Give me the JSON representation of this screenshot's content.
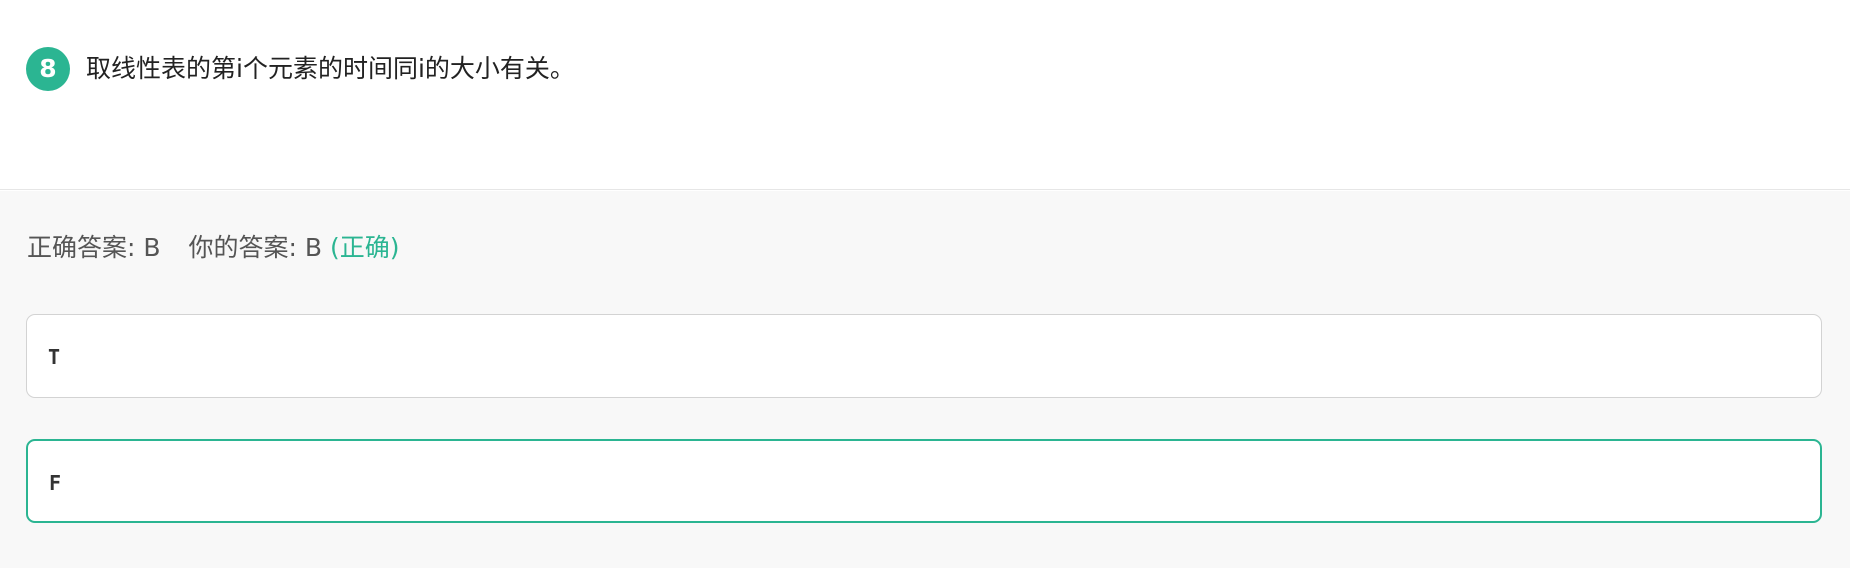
{
  "question": {
    "number": "8",
    "text": "取线性表的第i个元素的时间同i的大小有关。"
  },
  "answer": {
    "correct_label": "正确答案:",
    "correct_value": "B",
    "your_label": "你的答案:",
    "your_value": "B",
    "status": "(正确)"
  },
  "options": [
    {
      "label": "T"
    },
    {
      "label": "F"
    }
  ],
  "colors": {
    "accent": "#2bb592",
    "answer_bg": "#f8f8f8",
    "option_border": "#d3d3d3"
  }
}
